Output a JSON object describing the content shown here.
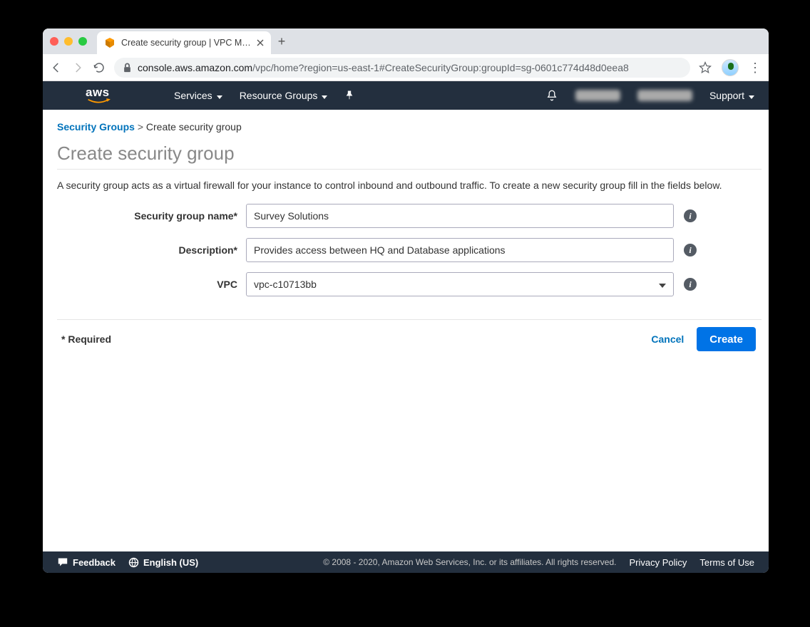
{
  "browser": {
    "tab_title": "Create security group | VPC M…",
    "url_host": "console.aws.amazon.com",
    "url_path": "/vpc/home?region=us-east-1#CreateSecurityGroup:groupId=sg-0601c774d48d0eea8"
  },
  "nav": {
    "services": "Services",
    "resource_groups": "Resource Groups",
    "support": "Support"
  },
  "breadcrumb": {
    "parent": "Security Groups",
    "sep": ">",
    "current": "Create security group"
  },
  "page": {
    "title": "Create security group",
    "helptext": "A security group acts as a virtual firewall for your instance to control inbound and outbound traffic. To create a new security group fill in the fields below."
  },
  "form": {
    "name_label": "Security group name*",
    "name_value": "Survey Solutions",
    "desc_label": "Description*",
    "desc_value": "Provides access between HQ and Database applications",
    "vpc_label": "VPC",
    "vpc_value": "vpc-c10713bb"
  },
  "actions": {
    "required_note": "* Required",
    "cancel": "Cancel",
    "create": "Create"
  },
  "footer": {
    "feedback": "Feedback",
    "language": "English (US)",
    "copyright": "© 2008 - 2020, Amazon Web Services, Inc. or its affiliates. All rights reserved.",
    "privacy": "Privacy Policy",
    "terms": "Terms of Use"
  }
}
